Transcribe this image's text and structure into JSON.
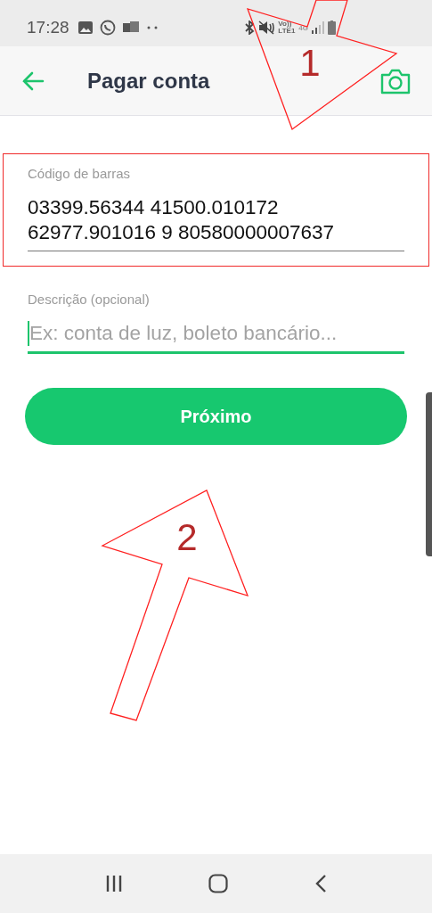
{
  "status_bar": {
    "time": "17:28",
    "volte": [
      "Vo))",
      "LTE1"
    ],
    "network": "4G"
  },
  "header": {
    "title": "Pagar conta"
  },
  "fields": [
    {
      "kind": "value",
      "label": "Código de barras",
      "value": "03399.56344 41500.010172 62977.901016 9 80580000007637",
      "focused": false,
      "highlighted": true
    },
    {
      "kind": "input",
      "label": "Descrição (opcional)",
      "placeholder": "Ex: conta de luz, boleto bancário...",
      "focused": true,
      "highlighted": false
    }
  ],
  "button": {
    "label": "Próximo"
  },
  "annotations": [
    {
      "number": "1"
    },
    {
      "number": "2"
    }
  ]
}
